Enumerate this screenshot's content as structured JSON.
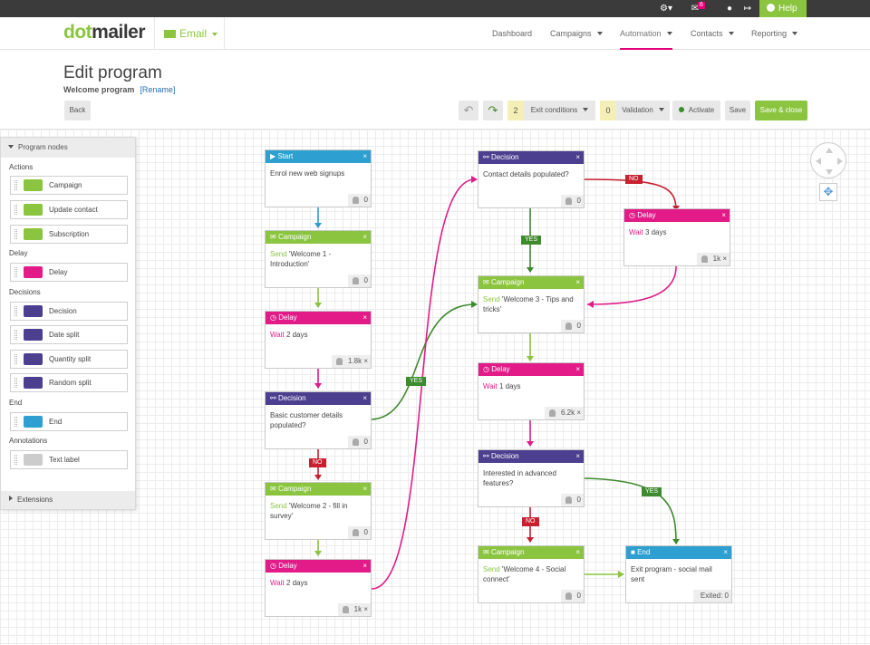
{
  "topbar": {
    "badge": "6",
    "help": "Help"
  },
  "logo": {
    "dot": "dot",
    "mailer": "mailer"
  },
  "product": {
    "label": "Email"
  },
  "nav": {
    "dashboard": "Dashboard",
    "campaigns": "Campaigns",
    "automation": "Automation",
    "contacts": "Contacts",
    "reporting": "Reporting"
  },
  "page": {
    "title": "Edit program",
    "program_name": "Welcome program",
    "rename": "[Rename]"
  },
  "toolbar": {
    "back": "Back",
    "exit_count": "2",
    "exit_label": "Exit conditions",
    "validation_count": "0",
    "validation_label": "Validation",
    "activate": "Activate",
    "save": "Save",
    "save_close": "Save & close"
  },
  "panel": {
    "title": "Program nodes",
    "extensions": "Extensions",
    "sections": {
      "actions": "Actions",
      "delay": "Delay",
      "decisions": "Decisions",
      "end": "End",
      "annotations": "Annotations"
    },
    "items": {
      "campaign": "Campaign",
      "update_contact": "Update contact",
      "subscription": "Subscription",
      "delay": "Delay",
      "decision": "Decision",
      "date_split": "Date split",
      "quantity_split": "Quantity split",
      "random_split": "Random split",
      "end": "End",
      "text_label": "Text label"
    }
  },
  "nodes": {
    "start": {
      "title": "Start",
      "body": "Enrol new web signups",
      "count": "0"
    },
    "campaign1": {
      "title": "Campaign",
      "verb": "Send",
      "body": "'Welcome 1 - Introduction'",
      "count": "0"
    },
    "delay1": {
      "title": "Delay",
      "verb": "Wait",
      "body": "2 days",
      "count": "1.8k"
    },
    "decision1": {
      "title": "Decision",
      "body": "Basic customer details populated?",
      "count": "0"
    },
    "campaign2": {
      "title": "Campaign",
      "verb": "Send",
      "body": "'Welcome 2 - fill in survey'",
      "count": "0"
    },
    "delay2": {
      "title": "Delay",
      "verb": "Wait",
      "body": "2 days",
      "count": "1k"
    },
    "decision2": {
      "title": "Decision",
      "body": "Contact details populated?",
      "count": "0"
    },
    "delay3": {
      "title": "Delay",
      "verb": "Wait",
      "body": "3 days",
      "count": "1k"
    },
    "campaign3": {
      "title": "Campaign",
      "verb": "Send",
      "body": "'Welcome 3 - Tips and tricks'",
      "count": "0"
    },
    "delay4": {
      "title": "Delay",
      "verb": "Wait",
      "body": "1 days",
      "count": "6.2k"
    },
    "decision3": {
      "title": "Decision",
      "body": "Interested in advanced features?",
      "count": "0"
    },
    "campaign4": {
      "title": "Campaign",
      "verb": "Send",
      "body": "'Welcome 4 - Social connect'",
      "count": "0"
    },
    "end": {
      "title": "End",
      "body": "Exit program - social mail sent",
      "count": "Exited: 0"
    }
  },
  "labels": {
    "yes": "YES",
    "no": "NO"
  },
  "colors": {
    "brand_green": "#8bc53f",
    "pink": "#e21b89",
    "purple": "#4c3f8f",
    "blue": "#2d9fd0",
    "yes": "#3e8a2e",
    "no": "#c8202f"
  }
}
